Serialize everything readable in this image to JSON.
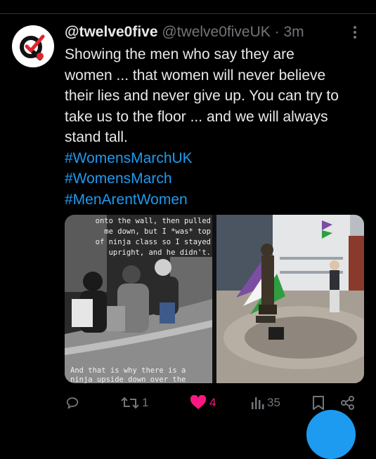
{
  "tweet": {
    "display_name": "@twelve0five",
    "handle": "@twelve0fiveUK",
    "separator": "·",
    "time": "3m",
    "text_lines": [
      "Showing the men who say they are",
      "women ... that women will never believe",
      "their lies and never give up. You can try to",
      "take us to the floor ... and we will always",
      "stand tall."
    ],
    "hashtags": [
      "#WomensMarchUK",
      "#WomensMarch",
      "#MenArentWomen"
    ]
  },
  "media": {
    "left_overlay_text": "onto the wall, then pulled\nme down, but I *was* top\nof ninja class so I stayed\nupright, and he didn't.",
    "left_overlay_bottom": "And that is why there is a\nninja upside down over the"
  },
  "actions": {
    "reply_count": "",
    "retweet_count": "1",
    "like_count": "4",
    "views_count": "35"
  },
  "colors": {
    "accent": "#1d9bf0",
    "like": "#f91880",
    "muted": "#71767b",
    "background": "#000000"
  }
}
